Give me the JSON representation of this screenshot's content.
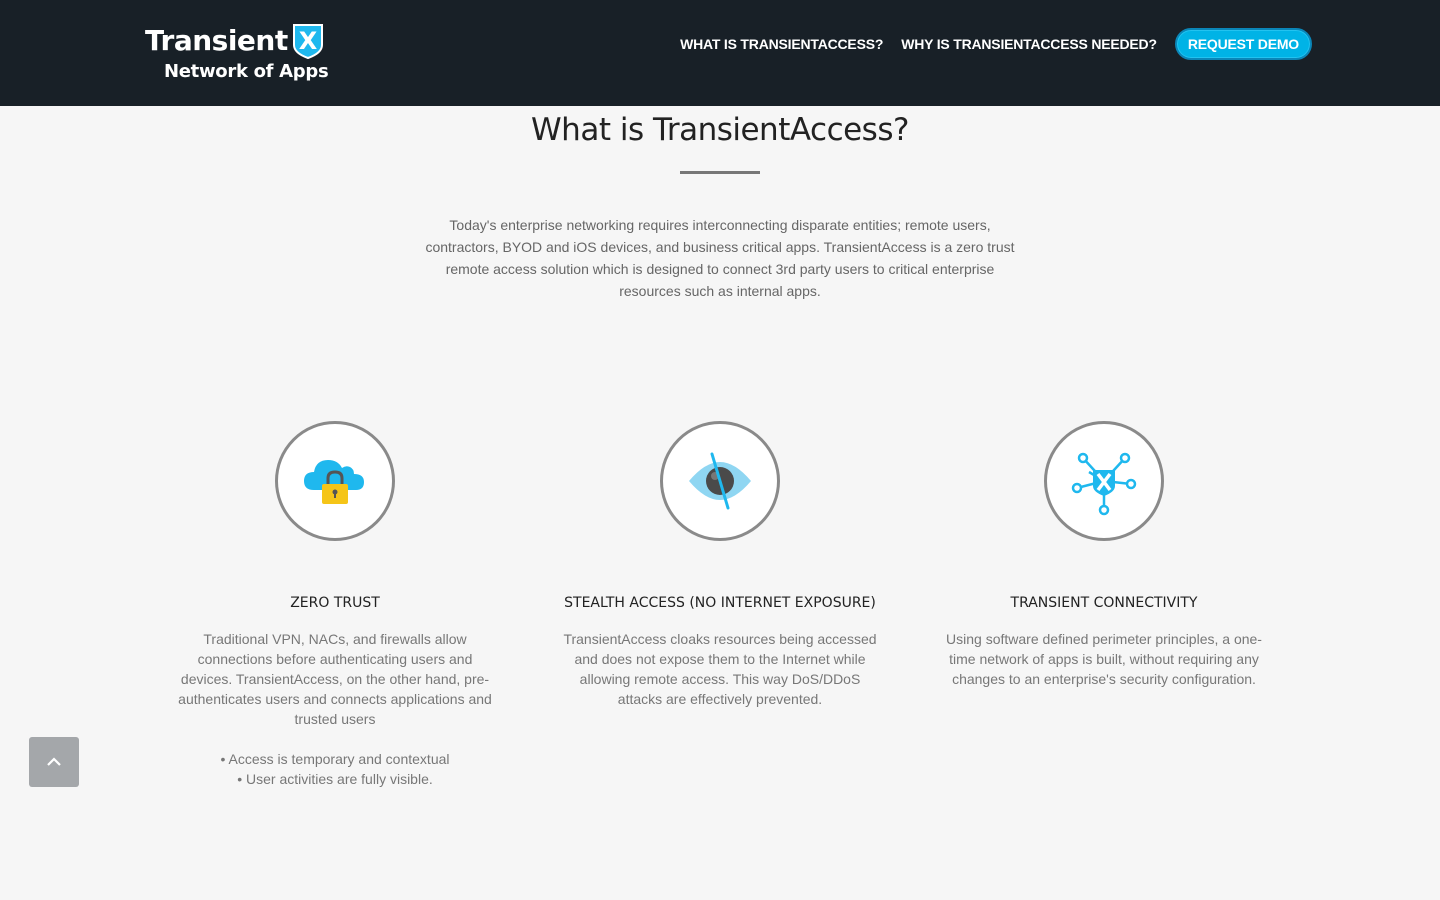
{
  "brand": {
    "word": "Transient",
    "x_letter": "X",
    "tagline": "Network of Apps"
  },
  "nav": {
    "items": [
      "WHAT IS TRANSIENTACCESS?",
      "WHY IS TRANSIENTACCESS NEEDED?"
    ],
    "cta": "REQUEST DEMO"
  },
  "section": {
    "title": "What is TransientAccess?",
    "intro": "Today's enterprise networking requires interconnecting disparate entities; remote users, contractors, BYOD and iOS devices, and business critical apps. TransientAccess is a zero trust remote access solution which is designed to connect 3rd party users to critical enterprise resources such as internal apps."
  },
  "features": [
    {
      "icon": "cloud-lock-icon",
      "title": "ZERO TRUST",
      "text": "Traditional VPN, NACs, and firewalls allow connections before authenticating users and devices. TransientAccess, on the other hand, pre-authenticates users and connects applications and trusted users",
      "bullets": [
        "• Access is temporary and contextual",
        "• User activities are fully visible."
      ]
    },
    {
      "icon": "hidden-eye-icon",
      "title": "STEALTH ACCESS (NO INTERNET EXPOSURE)",
      "text": "TransientAccess cloaks resources being accessed and does not expose them to the Internet while allowing remote access. This way DoS/DDoS attacks are effectively prevented."
    },
    {
      "icon": "network-hub-icon",
      "title": "TRANSIENT CONNECTIVITY",
      "text": "Using software defined perimeter principles, a one-time network of apps is built, without requiring any changes to an enterprise's security configuration."
    }
  ],
  "colors": {
    "header_bg": "#182027",
    "accent": "#00b3e6",
    "icon_blue": "#1fb8ee",
    "lock_yellow": "#f5c518"
  }
}
